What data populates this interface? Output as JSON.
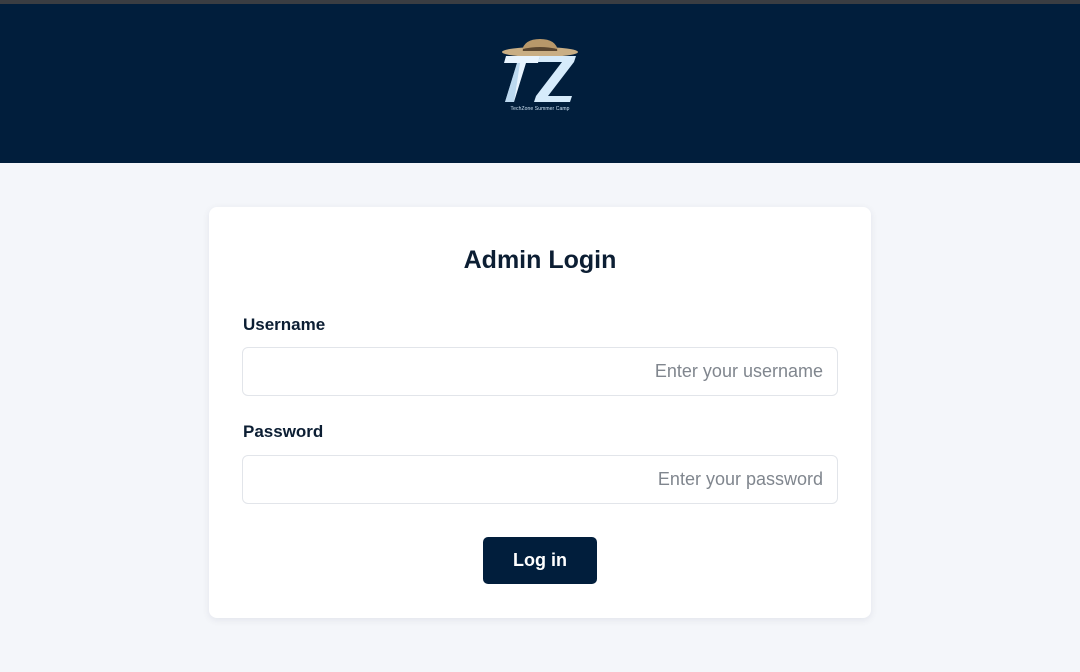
{
  "header": {
    "logo_text": "TZ",
    "logo_caption": "TechZone Summer Camp",
    "colors": {
      "header_bg": "#011e3c",
      "top_strip": "#3a3d42",
      "logo_letters": "#e8f4ff",
      "hat": "#c9ae84"
    }
  },
  "login": {
    "title": "Admin Login",
    "username": {
      "label": "Username",
      "placeholder": "Enter your username",
      "value": ""
    },
    "password": {
      "label": "Password",
      "placeholder": "Enter your password",
      "value": ""
    },
    "submit_label": "Log in"
  },
  "theme": {
    "page_bg": "#f4f6fa",
    "card_bg": "#ffffff",
    "primary": "#011e3c",
    "text_dark": "#0c1e33",
    "placeholder": "#80868e"
  }
}
